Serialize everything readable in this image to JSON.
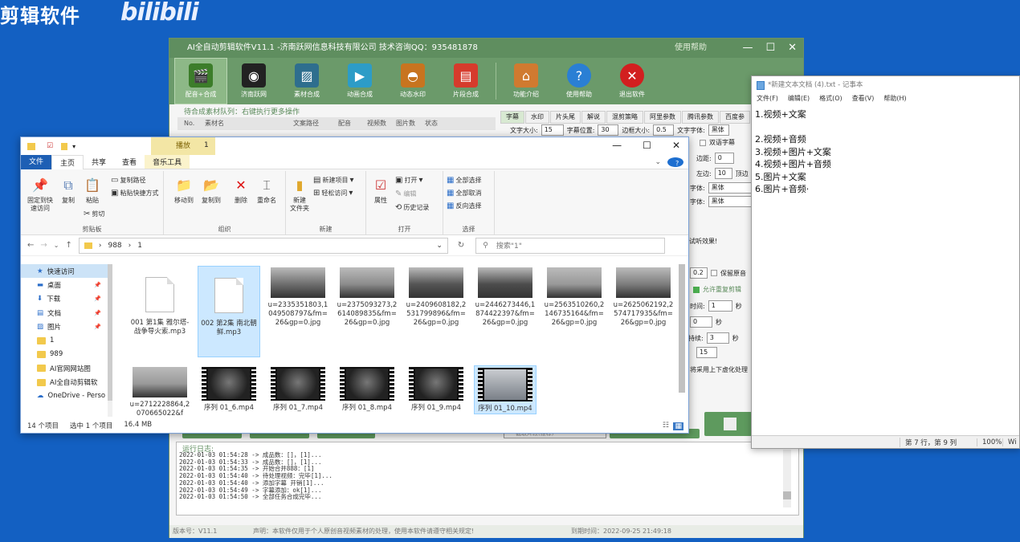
{
  "brand": {
    "text": "剪辑软件",
    "logo": "bilibili"
  },
  "ai_app": {
    "title": "AI全自动剪辑软件V11.1 -济南跃网信息科技有限公司 技术咨询QQ：935481878",
    "help": "使用帮助",
    "toolbar": [
      {
        "label": "配音+合成",
        "icon": "clapper-icon",
        "color": "#3c7d2a"
      },
      {
        "label": "济南跃网",
        "icon": "film-reel-icon",
        "color": "#222222"
      },
      {
        "label": "素材合成",
        "icon": "picture-icon",
        "color": "#2e6e8e"
      },
      {
        "label": "动画合成",
        "icon": "play-screen-icon",
        "color": "#2d9cc7"
      },
      {
        "label": "动态水印",
        "icon": "sunset-icon",
        "color": "#c8741f"
      },
      {
        "label": "片段合成",
        "icon": "film-doc-icon",
        "color": "#d63b2c"
      },
      {
        "label": "功能介绍",
        "icon": "house-icon",
        "color": "#d07a30"
      },
      {
        "label": "使用帮助",
        "icon": "question-icon",
        "color": "#2a7fd4"
      },
      {
        "label": "退出软件",
        "icon": "close-circle-icon",
        "color": "#d21f1f"
      }
    ],
    "queue_label": "待合成素材队列：右键执行更多操作",
    "queue_headers": [
      "No.",
      "素材名",
      "文案路径",
      "配音",
      "视频数",
      "图片数",
      "状态"
    ],
    "right_tabs": [
      "字幕",
      "水印",
      "片头尾",
      "解说",
      "混剪策略",
      "阿里参数",
      "腾讯参数",
      "百度参"
    ],
    "subtitle_row": {
      "font_size_label": "文字大小:",
      "font_size": "15",
      "pos_label": "字幕位置:",
      "pos": "30",
      "border_label": "边框大小:",
      "border": "0.5",
      "font_label": "文字字体:",
      "font": "黑体"
    },
    "right_fragments": {
      "dual": "双语字幕",
      "margin": "边距:",
      "margin_val": "0",
      "left": "左边:",
      "left_val": "10",
      "top": "顶边",
      "font1": "字体:",
      "font1_val": "黑体",
      "font2": "字体:",
      "font2_val": "黑体",
      "preview": "试听效果!",
      "val02": "0.2",
      "keep": "保留原音",
      "allow": "允许重复剪辑",
      "time": "时间:",
      "time_val": "1",
      "sec1": "秒",
      "zero": "0",
      "sec2": "秒",
      "dur": "持续:",
      "dur_val": "3",
      "sec3": "秒",
      "v15": "15",
      "blur": "将采用上下虚化处理",
      "low_label": "截取片段(推荐)"
    },
    "log_title": "运行日志:",
    "log_lines": [
      "2022-01-03 01:54:28 -> 成品数：[]，[1]...",
      "2022-01-03 01:54:33 -> 成品数：[]，[1]...",
      "2022-01-03 01:54:35 -> 开始合并888：[1]",
      "2022-01-03 01:54:40 -> 待处理视频：完毕[1]...",
      "2022-01-03 01:54:40 -> 添加字幕 开销[1]...",
      "2022-01-03 01:54:49 -> 字幕添加：ok[1]...",
      "2022-01-03 01:54:50 -> 全部任务合成完毕..."
    ],
    "status": {
      "version": "版本号：V11.1",
      "notice": "声明：本软件仅用于个人原创音视频素材的处理，使用本软件请遵守相关规定!",
      "expire": "到期时间：2022-09-25 21:49:18"
    }
  },
  "explorer": {
    "title_folder": "1",
    "context_tab": "播放",
    "tabs": [
      "文件",
      "主页",
      "共享",
      "查看",
      "音乐工具"
    ],
    "ribbon": {
      "pin": "固定到快\n速访问",
      "copy": "复制",
      "paste": "粘贴",
      "copy_path": "复制路径",
      "paste_shortcut": "粘贴快捷方式",
      "cut": "剪切",
      "clipboard": "剪贴板",
      "move_to": "移动到",
      "copy_to": "复制到",
      "delete": "删除",
      "rename": "重命名",
      "organize": "组织",
      "new_folder": "新建\n文件夹",
      "new_item": "新建项目",
      "easy_access": "轻松访问",
      "new": "新建",
      "properties": "属性",
      "open": "打开",
      "edit": "编辑",
      "history": "历史记录",
      "open_group": "打开",
      "select_all": "全部选择",
      "select_none": "全部取消",
      "invert": "反向选择",
      "select": "选择"
    },
    "path": [
      "988",
      "1"
    ],
    "search_placeholder": "搜索\"1\"",
    "nav": [
      {
        "label": "快速访问",
        "icon": "star-icon",
        "pin": false
      },
      {
        "label": "桌面",
        "icon": "desktop-icon",
        "pin": true
      },
      {
        "label": "下载",
        "icon": "download-icon",
        "pin": true
      },
      {
        "label": "文档",
        "icon": "document-icon",
        "pin": true
      },
      {
        "label": "图片",
        "icon": "pictures-icon",
        "pin": true
      },
      {
        "label": "1",
        "icon": "folder-icon",
        "pin": false
      },
      {
        "label": "989",
        "icon": "folder-icon",
        "pin": false
      },
      {
        "label": "AI官网网站图",
        "icon": "folder-icon",
        "pin": false
      },
      {
        "label": "AI全自动剪辑软",
        "icon": "folder-icon",
        "pin": false
      },
      {
        "label": "OneDrive - Perso",
        "icon": "cloud-icon",
        "pin": false
      }
    ],
    "files": [
      {
        "name": "001 第1集 雅尔塔-战争导火索.mp3",
        "kind": "doc"
      },
      {
        "name": "002 第2集 南北朝鲜.mp3",
        "kind": "doc",
        "selected": true
      },
      {
        "name": "u=2335351803,1049508797&fm=26&gp=0.jpg",
        "kind": "photo"
      },
      {
        "name": "u=2375093273,2614089835&fm=26&gp=0.jpg",
        "kind": "photo"
      },
      {
        "name": "u=2409608182,2531799896&fm=26&gp=0.jpg",
        "kind": "photo"
      },
      {
        "name": "u=2446273446,1874422397&fm=26&gp=0.jpg",
        "kind": "photo"
      },
      {
        "name": "u=2563510260,2146735164&fm=26&gp=0.jpg",
        "kind": "photo"
      },
      {
        "name": "u=2625062192,2574717935&fm=26&gp=0.jpg",
        "kind": "photo"
      },
      {
        "name": "u=2712228864,2070665022&f",
        "kind": "photo"
      },
      {
        "name": "序列 01_6.mp4",
        "kind": "video"
      },
      {
        "name": "序列 01_7.mp4",
        "kind": "video"
      },
      {
        "name": "序列 01_8.mp4",
        "kind": "video"
      },
      {
        "name": "序列 01_9.mp4",
        "kind": "video"
      },
      {
        "name": "序列 01_10.mp4",
        "kind": "video",
        "selected": true
      }
    ],
    "status": {
      "count": "14 个项目",
      "selected": "选中 1 个项目",
      "size": "16.4 MB"
    }
  },
  "notepad": {
    "title": "*新建文本文档 (4).txt - 记事本",
    "menu": [
      "文件(F)",
      "编辑(E)",
      "格式(O)",
      "查看(V)",
      "帮助(H)"
    ],
    "lines": [
      "1.视频+文案",
      "",
      "2.视频+音频",
      "3.视频+图片+文案",
      "4.视频+图片+音频",
      "5.图片+文案",
      "6.图片+音频·"
    ],
    "status": {
      "pos": "第 7 行，第 9 列",
      "zoom": "100%",
      "enc": "Wi"
    }
  }
}
